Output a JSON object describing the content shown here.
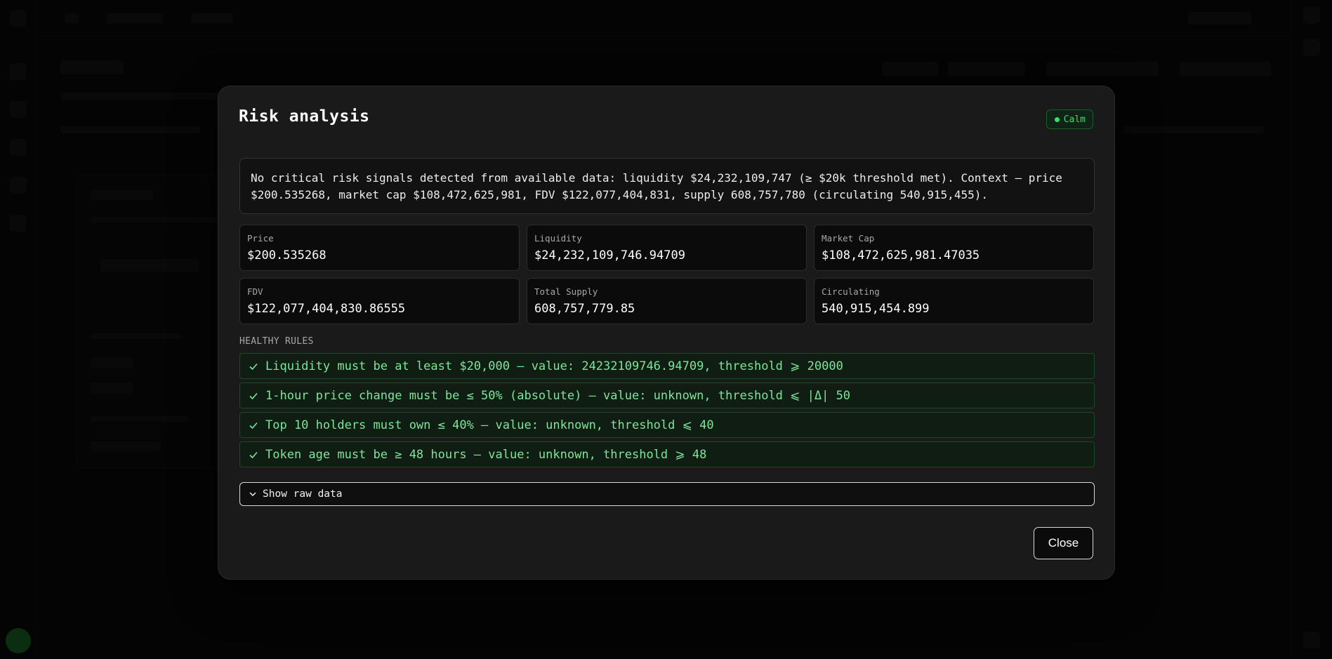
{
  "modal": {
    "title": "Risk analysis",
    "status": "Calm",
    "summary": "No critical risk signals detected from available data: liquidity $24,232,109,747 (≥ $20k threshold met). Context — price $200.535268, market cap $108,472,625,981, FDV $122,077,404,831, supply 608,757,780 (circulating 540,915,455).",
    "stats": [
      {
        "label": "Price",
        "value": "$200.535268"
      },
      {
        "label": "Liquidity",
        "value": "$24,232,109,746.94709"
      },
      {
        "label": "Market Cap",
        "value": "$108,472,625,981.47035"
      },
      {
        "label": "FDV",
        "value": "$122,077,404,830.86555"
      },
      {
        "label": "Total Supply",
        "value": "608,757,779.85"
      },
      {
        "label": "Circulating",
        "value": "540,915,454.899"
      }
    ],
    "rules_heading": "HEALTHY RULES",
    "rules": [
      "Liquidity must be at least $20,000 — value: 24232109746.94709, threshold ⩾ 20000",
      "1-hour price change must be ≤ 50% (absolute) — value: unknown, threshold ⩽ |Δ| 50",
      "Top 10 holders must own ≤ 40% — value: unknown, threshold ⩽ 40",
      "Token age must be ≥ 48 hours — value: unknown, threshold ⩾ 48"
    ],
    "raw_toggle_label": "Show raw data",
    "close_label": "Close"
  },
  "colors": {
    "accent_green": "#3ddc6a",
    "rule_text": "#7ee59a",
    "modal_bg": "#1a1a1a"
  },
  "icons": {
    "rule": "check-icon",
    "toggle": "chevron-down-icon",
    "status": "status-dot-icon"
  }
}
